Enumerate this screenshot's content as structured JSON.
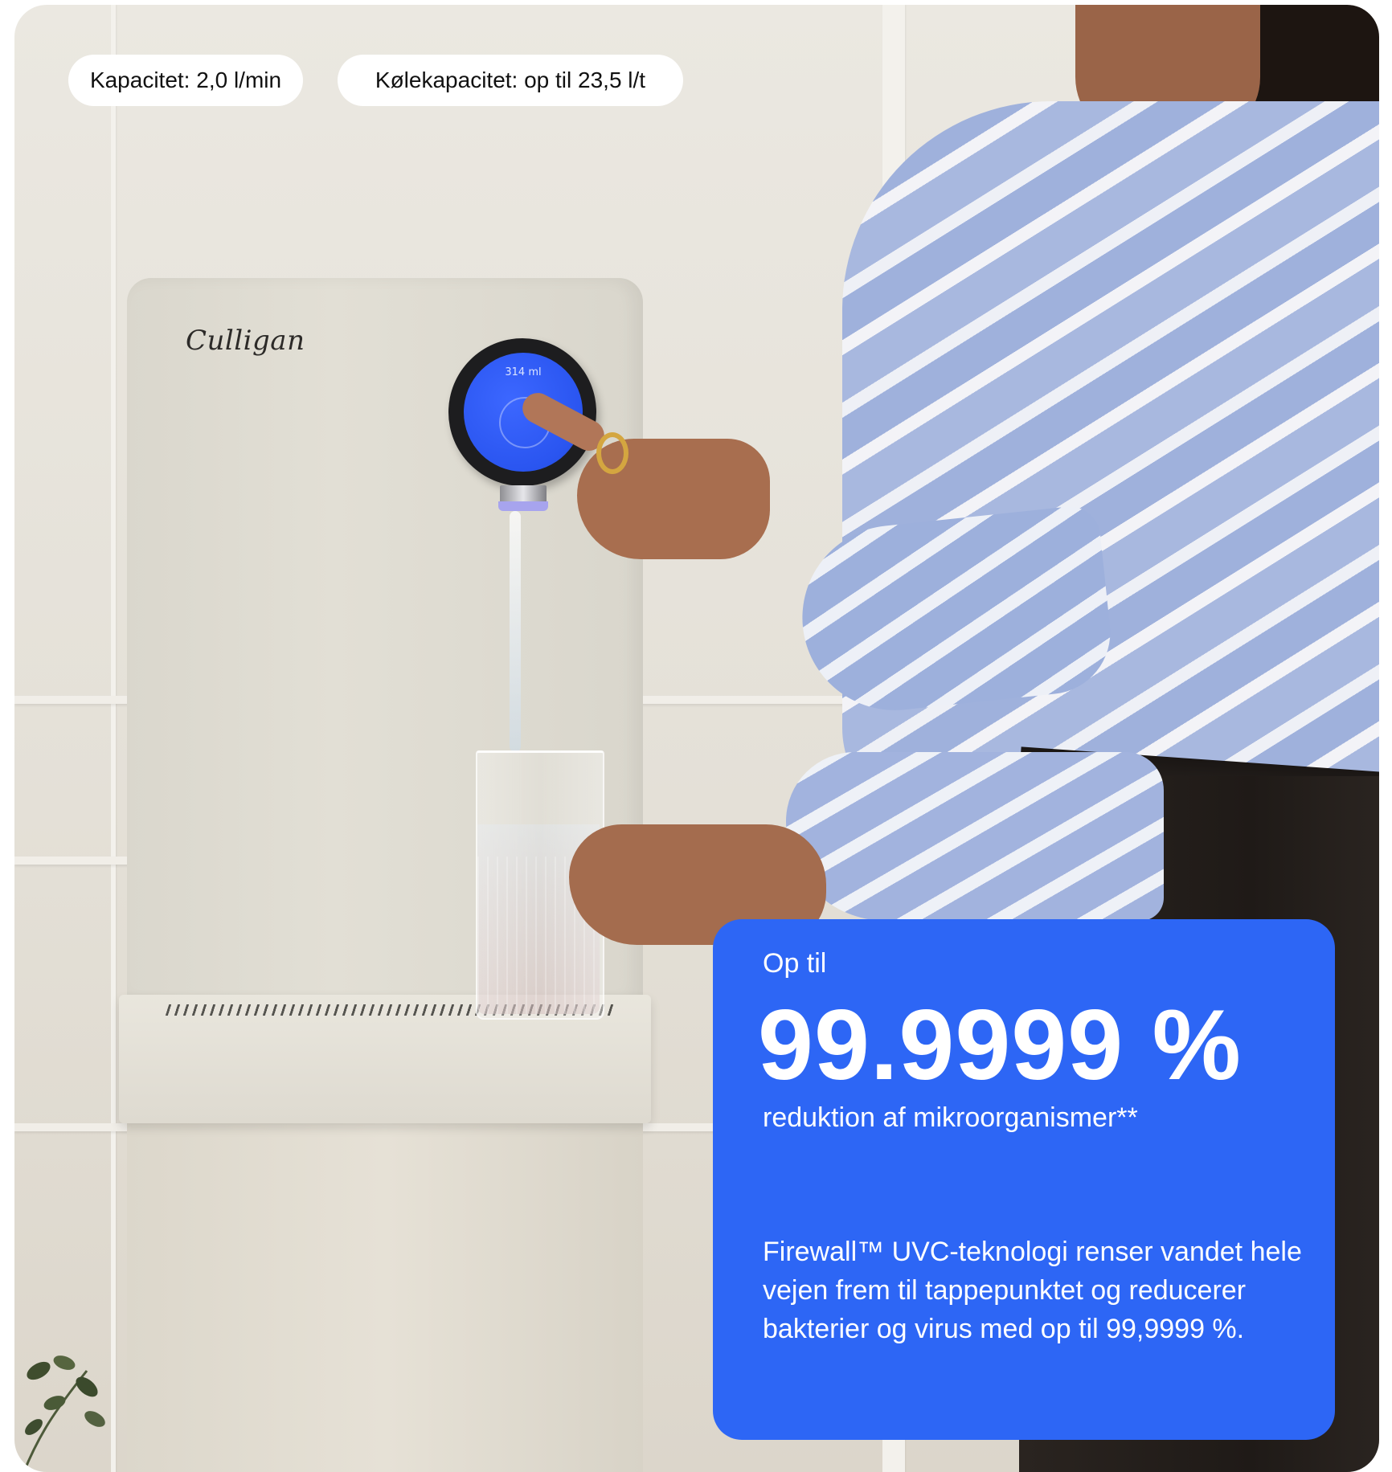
{
  "specs": {
    "capacity": "Kapacitet: 2,0 l/min",
    "cooling_capacity": "Kølekapacitet: op til 23,5 l/t"
  },
  "product": {
    "brand_logo": "Culligan",
    "display_volume": "314 ml"
  },
  "highlight": {
    "prefix": "Op til",
    "value": "99.9999 %",
    "caption": "reduktion af mikroorganismer**",
    "body": "Firewall™ UVC-teknologi renser vandet hele vejen frem til tappepunktet og reducerer bakterier og virus med op til 99,9999 %."
  },
  "colors": {
    "accent_blue": "#2d66f5",
    "pill_background": "#ffffff",
    "dispenser_body": "#e0ddd3"
  }
}
